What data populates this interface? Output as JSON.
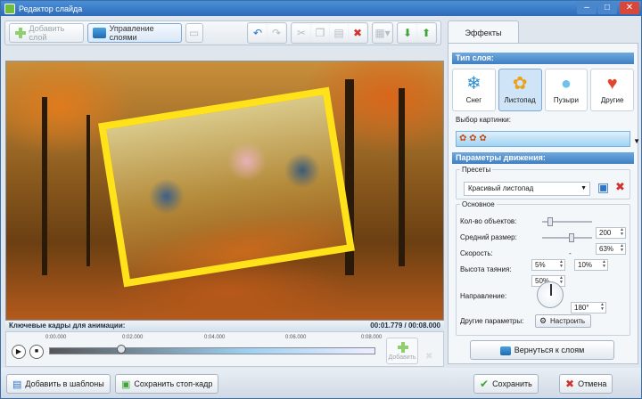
{
  "window": {
    "title": "Редактор слайда"
  },
  "toolbar": {
    "add_layer": "Добавить слой",
    "manage_layers": "Управление слоями"
  },
  "timeline": {
    "header": "Ключевые кадры для анимации:",
    "time": "00:01.779 / 00:08.000",
    "ticks": [
      "0:00.000",
      "0:02.000",
      "0:04.000",
      "0:06.000",
      "0:08.000"
    ],
    "add": "Добавить",
    "position_fraction": 0.222
  },
  "bottom": {
    "add_template": "Добавить в шаблоны",
    "save_frame": "Сохранить стоп-кадр",
    "save": "Сохранить",
    "cancel": "Отмена"
  },
  "effects": {
    "tab": "Эффекты",
    "layer_type_header": "Тип слоя:",
    "types": [
      {
        "label": "Снег",
        "icon": "snowflake-icon",
        "selected": false
      },
      {
        "label": "Листопад",
        "icon": "maple-leaf-icon",
        "selected": true
      },
      {
        "label": "Пузыри",
        "icon": "bubble-icon",
        "selected": false
      },
      {
        "label": "Другие",
        "icon": "heart-icon",
        "selected": false
      }
    ],
    "picture_label": "Выбор картинки:",
    "motion_header": "Параметры движения:",
    "presets_label": "Пресеты",
    "preset_value": "Красивый листопад",
    "basic_label": "Основное",
    "count_label": "Кол-во объектов:",
    "count_value": "200",
    "size_label": "Средний размер:",
    "size_value": "63%",
    "speed_label": "Скорость:",
    "speed_from": "5%",
    "speed_dash": "-",
    "speed_to": "10%",
    "melt_label": "Высота таяния:",
    "melt_value": "50%",
    "direction_label": "Направление:",
    "direction_value": "180°",
    "other_label": "Другие параметры:",
    "setup_button": "Настроить",
    "back_button": "Вернуться к слоям"
  },
  "colors": {
    "accent": "#3f7fc2",
    "frame": "#ffe21a"
  }
}
